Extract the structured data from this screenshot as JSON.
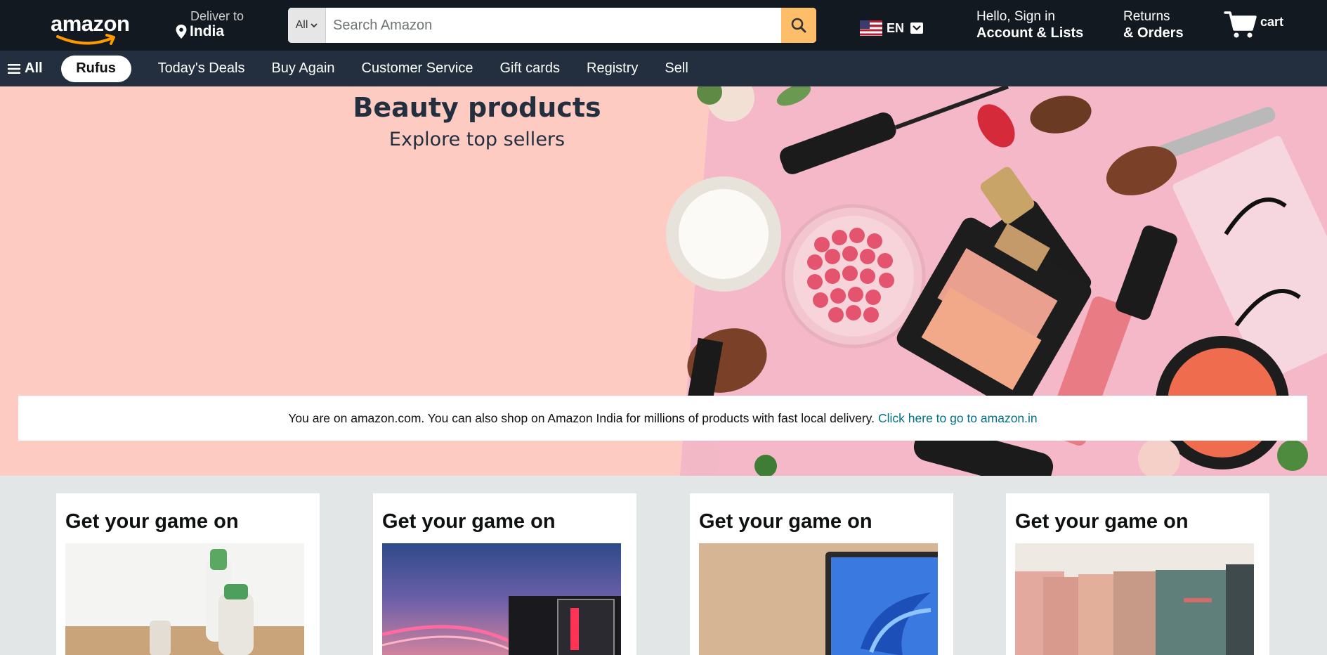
{
  "header": {
    "logo_text": "amazon",
    "deliver_label": "Deliver to",
    "deliver_location": "India",
    "search_category": "All",
    "search_placeholder": "Search Amazon",
    "language": "EN",
    "account_greeting": "Hello, Sign in",
    "account_label": "Account & Lists",
    "returns_line1": "Returns",
    "returns_line2": "& Orders",
    "cart_label": "cart"
  },
  "subnav": {
    "all_label": "All",
    "rufus_label": "Rufus",
    "links": [
      "Today's Deals",
      "Buy Again",
      "Customer Service",
      "Gift cards",
      "Registry",
      "Sell"
    ]
  },
  "hero": {
    "title": "Beauty products",
    "subtitle": "Explore top sellers",
    "background": "#fecbc2"
  },
  "notice": {
    "text": "You are on amazon.com. You can also shop on Amazon India for millions of products with fast local delivery.",
    "link_text": "Click here to go to amazon.in"
  },
  "cards": [
    {
      "title": "Get your game on",
      "image": "cleaning-products"
    },
    {
      "title": "Get your game on",
      "image": "gaming-pc"
    },
    {
      "title": "Get your game on",
      "image": "laptop"
    },
    {
      "title": "Get your game on",
      "image": "handbags"
    }
  ],
  "colors": {
    "header_bg": "#131921",
    "subnav_bg": "#232f3e",
    "search_button": "#febd69",
    "link": "#007185",
    "page_bg": "#e3e6e6"
  }
}
